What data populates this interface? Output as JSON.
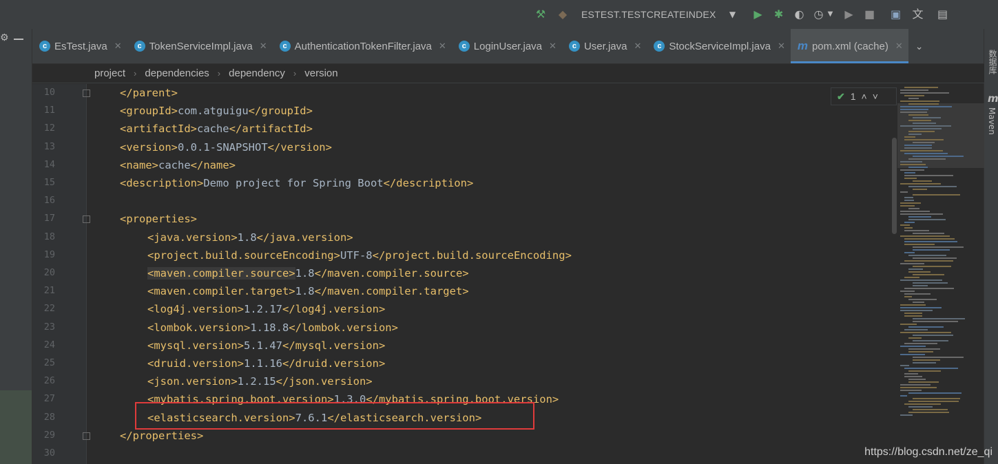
{
  "toolbar": {
    "run_config": "ESTEST.TESTCREATEINDEX"
  },
  "tabs": [
    {
      "label": "EsTest.java",
      "icon": "class-icon"
    },
    {
      "label": "TokenServiceImpl.java",
      "icon": "class-icon"
    },
    {
      "label": "AuthenticationTokenFilter.java",
      "icon": "class-icon"
    },
    {
      "label": "LoginUser.java",
      "icon": "class-icon"
    },
    {
      "label": "User.java",
      "icon": "class-icon"
    },
    {
      "label": "StockServiceImpl.java",
      "icon": "class-icon"
    },
    {
      "label": "pom.xml (cache)",
      "icon": "maven-icon",
      "active": true
    }
  ],
  "breadcrumb": [
    "project",
    "dependencies",
    "dependency",
    "version"
  ],
  "right_strip": {
    "database": "数据库",
    "maven": "Maven"
  },
  "inspection": {
    "count": "1"
  },
  "lines": [
    {
      "n": "10",
      "indent": 1,
      "open": "</parent>",
      "text": "",
      "close": ""
    },
    {
      "n": "11",
      "indent": 1,
      "open": "<groupId>",
      "text": "com.atguigu",
      "close": "</groupId>"
    },
    {
      "n": "12",
      "indent": 1,
      "open": "<artifactId>",
      "text": "cache",
      "close": "</artifactId>"
    },
    {
      "n": "13",
      "indent": 1,
      "open": "<version>",
      "text": "0.0.1-SNAPSHOT",
      "close": "</version>"
    },
    {
      "n": "14",
      "indent": 1,
      "open": "<name>",
      "text": "cache",
      "close": "</name>"
    },
    {
      "n": "15",
      "indent": 1,
      "open": "<description>",
      "text": "Demo project for Spring Boot",
      "close": "</description>"
    },
    {
      "n": "16",
      "indent": 0,
      "open": "",
      "text": "",
      "close": ""
    },
    {
      "n": "17",
      "indent": 1,
      "open": "<properties>",
      "text": "",
      "close": ""
    },
    {
      "n": "18",
      "indent": 2,
      "open": "<java.version>",
      "text": "1.8",
      "close": "</java.version>"
    },
    {
      "n": "19",
      "indent": 2,
      "open": "<project.build.sourceEncoding>",
      "text": "UTF-8",
      "close": "</project.build.sourceEncoding>"
    },
    {
      "n": "20",
      "indent": 2,
      "open": "<maven.compiler.source>",
      "text": "1.8",
      "close": "</maven.compiler.source>",
      "highlight": true
    },
    {
      "n": "21",
      "indent": 2,
      "open": "<maven.compiler.target>",
      "text": "1.8",
      "close": "</maven.compiler.target>"
    },
    {
      "n": "22",
      "indent": 2,
      "open": "<log4j.version>",
      "text": "1.2.17",
      "close": "</log4j.version>"
    },
    {
      "n": "23",
      "indent": 2,
      "open": "<lombok.version>",
      "text": "1.18.8",
      "close": "</lombok.version>"
    },
    {
      "n": "24",
      "indent": 2,
      "open": "<mysql.version>",
      "text": "5.1.47",
      "close": "</mysql.version>"
    },
    {
      "n": "25",
      "indent": 2,
      "open": "<druid.version>",
      "text": "1.1.16",
      "close": "</druid.version>"
    },
    {
      "n": "26",
      "indent": 2,
      "open": "<json.version>",
      "text": "1.2.15",
      "close": "</json.version>"
    },
    {
      "n": "27",
      "indent": 2,
      "open": "<mybatis.spring.boot.version>",
      "text": "1.3.0",
      "close": "</mybatis.spring.boot.version>"
    },
    {
      "n": "28",
      "indent": 2,
      "open": "<elasticsearch.version>",
      "text": "7.6.1",
      "close": "</elasticsearch.version>"
    },
    {
      "n": "29",
      "indent": 1,
      "open": "</properties>",
      "text": "",
      "close": ""
    },
    {
      "n": "30",
      "indent": 0,
      "open": "",
      "text": "",
      "close": ""
    }
  ],
  "watermark": "https://blog.csdn.net/ze_qi",
  "colors": {
    "tag": "#e8bf6a",
    "text": "#a9b7c6",
    "annotation_box": "#e03b3b",
    "accent": "#4a88c7"
  }
}
